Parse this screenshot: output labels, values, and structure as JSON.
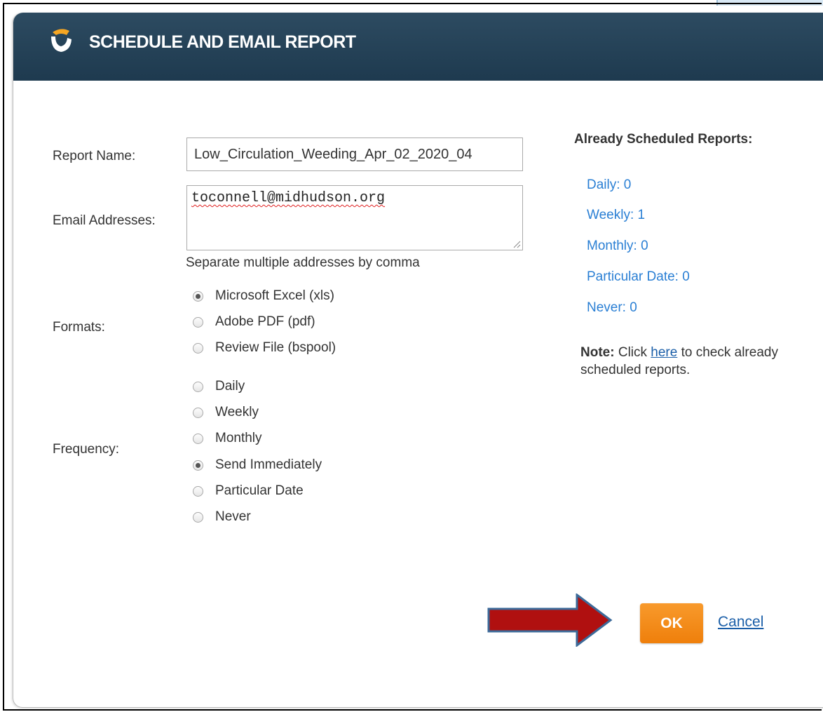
{
  "dialog": {
    "title": "SCHEDULE AND EMAIL REPORT"
  },
  "form": {
    "report_name_label": "Report Name:",
    "report_name_value": "Low_Circulation_Weeding_Apr_02_2020_04",
    "email_label": "Email Addresses:",
    "email_value": "toconnell@midhudson.org",
    "email_hint": "Separate multiple addresses by comma",
    "formats_label": "Formats:",
    "formats": [
      {
        "label": "Microsoft Excel (xls)",
        "checked": true
      },
      {
        "label": "Adobe PDF (pdf)",
        "checked": false
      },
      {
        "label": "Review File (bspool)",
        "checked": false
      }
    ],
    "frequency_label": "Frequency:",
    "frequencies": [
      {
        "label": "Daily",
        "checked": false
      },
      {
        "label": "Weekly",
        "checked": false
      },
      {
        "label": "Monthly",
        "checked": false
      },
      {
        "label": "Send Immediately",
        "checked": true
      },
      {
        "label": "Particular Date",
        "checked": false
      },
      {
        "label": "Never",
        "checked": false
      }
    ]
  },
  "scheduled": {
    "title": "Already Scheduled Reports:",
    "items": [
      "Daily: 0",
      "Weekly: 1",
      "Monthly: 0",
      "Particular Date: 0",
      "Never: 0"
    ]
  },
  "note": {
    "bold": "Note:",
    "before": " Click ",
    "link": "here",
    "after": " to check already scheduled reports."
  },
  "buttons": {
    "ok": "OK",
    "cancel": "Cancel"
  },
  "colors": {
    "header": "#1e3a4f",
    "accent_orange": "#f28a1a",
    "link_blue": "#2a7fd4",
    "arrow_red": "#b01010"
  },
  "icons": {
    "logo": "brand-logo-icon",
    "arrow": "callout-arrow-icon"
  }
}
